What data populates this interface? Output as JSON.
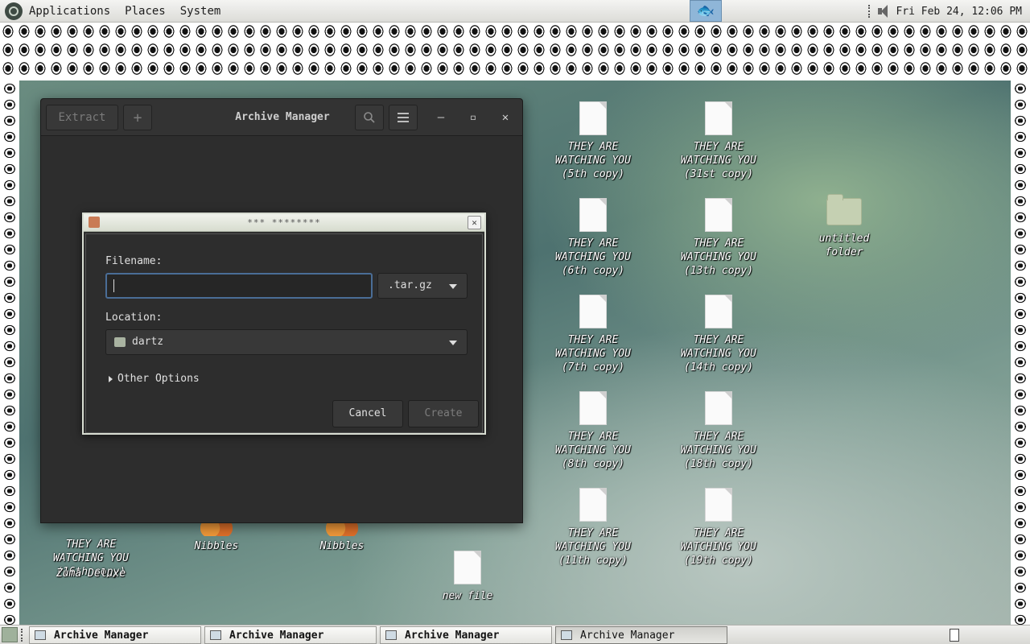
{
  "top_panel": {
    "menus": [
      "Applications",
      "Places",
      "System"
    ],
    "clock": "Fri Feb 24, 12:06 PM"
  },
  "desktop": {
    "icons": [
      {
        "label": "THEY ARE\nWATCHING YOU\n(5th copy)",
        "type": "file"
      },
      {
        "label": "THEY ARE\nWATCHING YOU\n(31st copy)",
        "type": "file"
      },
      {
        "label": "THEY ARE\nWATCHING YOU\n(6th copy)",
        "type": "file"
      },
      {
        "label": "THEY ARE\nWATCHING YOU\n(13th copy)",
        "type": "file"
      },
      {
        "label": "untitled folder",
        "type": "folder"
      },
      {
        "label": "THEY ARE\nWATCHING YOU\n(7th copy)",
        "type": "file"
      },
      {
        "label": "THEY ARE\nWATCHING YOU\n(14th copy)",
        "type": "file"
      },
      {
        "label": "THEY ARE\nWATCHING YOU\n(8th copy)",
        "type": "file"
      },
      {
        "label": "THEY ARE\nWATCHING YOU\n(18th copy)",
        "type": "file"
      },
      {
        "label": "THEY ARE\nWATCHING YOU\n(11th copy)",
        "type": "file"
      },
      {
        "label": "THEY ARE\nWATCHING YOU\n(19th copy)",
        "type": "file"
      },
      {
        "label": "THEY ARE\nWATCHING YOU\n(16th copy)",
        "type": "file"
      },
      {
        "label": "Zuma Deluxe",
        "type": "app"
      },
      {
        "label": "Nibbles",
        "type": "app"
      },
      {
        "label": "Nibbles",
        "type": "app"
      },
      {
        "label": "new file",
        "type": "file"
      }
    ]
  },
  "archive_manager": {
    "title": "Archive Manager",
    "extract_label": "Extract",
    "add_label": "+",
    "search_icon": "search-icon",
    "menu_icon": "hamburger-icon",
    "min_glyph": "–",
    "max_glyph": "▫",
    "close_glyph": "✕"
  },
  "dialog": {
    "title": "*** ********",
    "close_glyph": "✕",
    "filename_label": "Filename:",
    "filename_value": "",
    "extension": ".tar.gz",
    "location_label": "Location:",
    "location_value": "dartz",
    "other_options": "Other Options",
    "cancel_label": "Cancel",
    "create_label": "Create"
  },
  "taskbar": {
    "tasks": [
      {
        "label": "Archive Manager"
      },
      {
        "label": "Archive Manager"
      },
      {
        "label": "Archive Manager"
      },
      {
        "label": "Archive Manager"
      }
    ]
  },
  "colors": {
    "focus_border": "#4a6d96",
    "window_bg": "#2d2d2d",
    "panel_bg": "#e6e6e2"
  }
}
